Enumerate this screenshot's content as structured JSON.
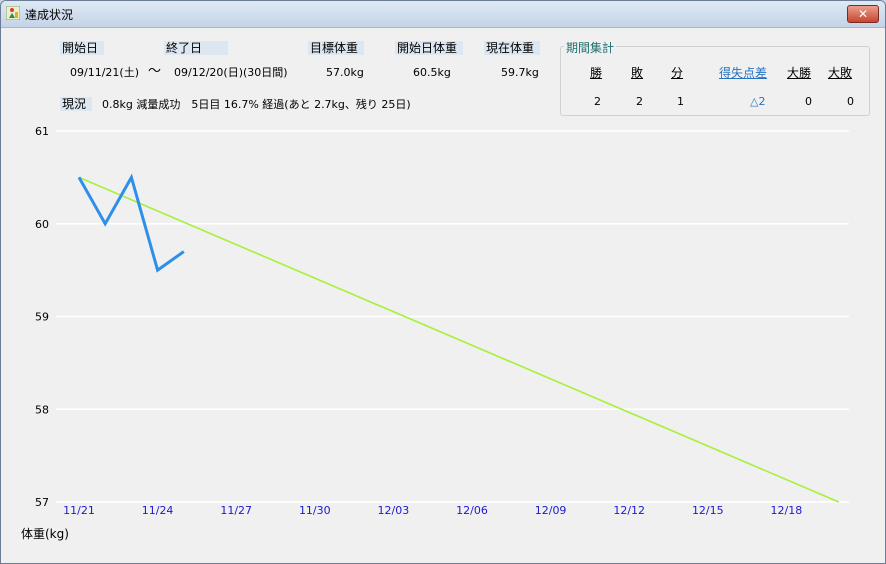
{
  "window": {
    "title": "達成状況",
    "close_label": "✕"
  },
  "summary": {
    "start_label": "開始日",
    "end_label": "終了日",
    "target_label": "目標体重",
    "start_weight_label": "開始日体重",
    "current_weight_label": "現在体重",
    "start_date": "09/11/21(土)",
    "tilde": "～",
    "end_date": "09/12/20(日)(30日間)",
    "target_weight": "57.0kg",
    "start_weight": "60.5kg",
    "current_weight": "59.7kg",
    "status_label": "現況",
    "status_text": "0.8kg 減量成功　5日目 16.7% 経過(あと 2.7kg、残り 25日)"
  },
  "period": {
    "title": "期間集計",
    "headers": {
      "win": "勝",
      "lose": "敗",
      "draw": "分",
      "diff": "得失点差",
      "big_win": "大勝",
      "big_lose": "大敗"
    },
    "values": {
      "win": "2",
      "lose": "2",
      "draw": "1",
      "diff": "△2",
      "big_win": "0",
      "big_lose": "0"
    }
  },
  "chart_data": {
    "type": "line",
    "ylabel": "体重(kg)",
    "ylim": [
      57,
      61
    ],
    "yticks": [
      "57",
      "58",
      "59",
      "60",
      "61"
    ],
    "xticks": [
      "11/21",
      "11/24",
      "11/27",
      "11/30",
      "12/03",
      "12/06",
      "12/09",
      "12/12",
      "12/15",
      "12/18"
    ],
    "grid": true,
    "colors": {
      "actual": "#2e8fe8",
      "target": "#a6f03a",
      "tick": "#1a1acf"
    },
    "series": [
      {
        "name": "",
        "points": [
          [
            0,
            60.5
          ],
          [
            1,
            60.0
          ],
          [
            2,
            60.5
          ],
          [
            3,
            59.5
          ],
          [
            4,
            59.7
          ]
        ]
      },
      {
        "name": "",
        "points": [
          [
            0,
            60.5
          ],
          [
            29,
            57.0
          ]
        ]
      }
    ]
  }
}
